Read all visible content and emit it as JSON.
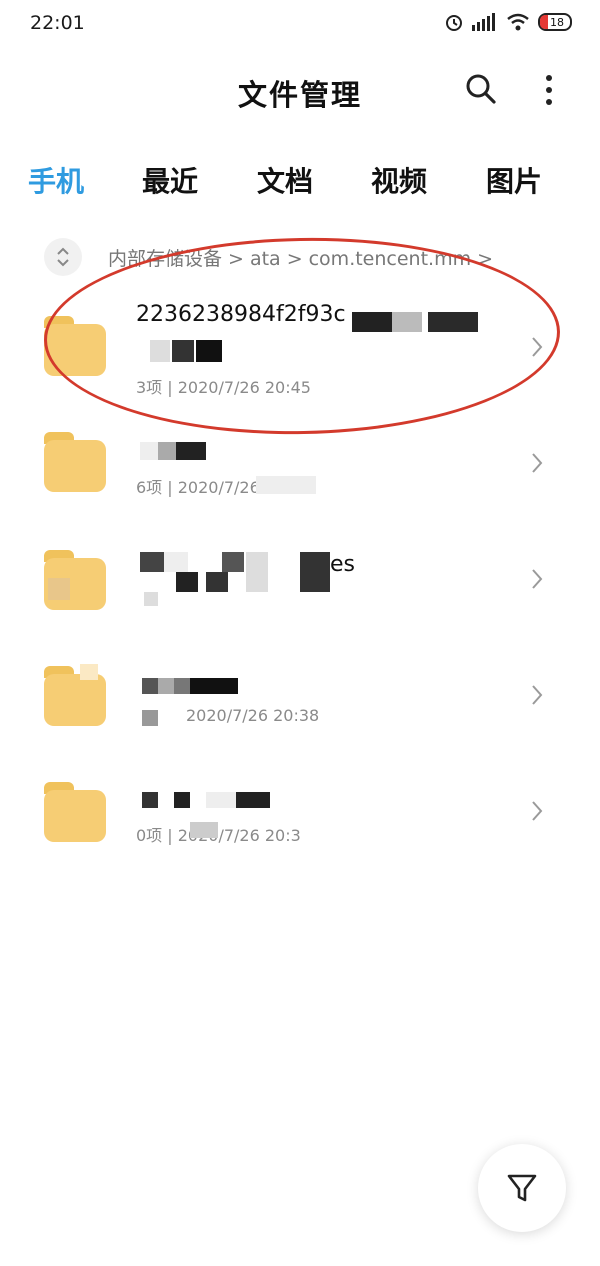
{
  "status_bar": {
    "time": "22:01",
    "battery": "18"
  },
  "header": {
    "title": "文件管理"
  },
  "tabs": [
    {
      "label": "手机",
      "active": true
    },
    {
      "label": "最近"
    },
    {
      "label": "文档"
    },
    {
      "label": "视频"
    },
    {
      "label": "图片"
    }
  ],
  "breadcrumb": {
    "items": [
      "内部存储设备",
      "ata",
      "com.tencent.mm"
    ]
  },
  "files": [
    {
      "name": "2236238984f2f93c",
      "meta": "3项 | 2020/7/26 20:45"
    },
    {
      "name": "",
      "meta": "6项 | 2020/7/26"
    },
    {
      "name": "es",
      "meta": ""
    },
    {
      "name": "",
      "meta": "2020/7/26 20:38"
    },
    {
      "name": "",
      "meta": "0项 | 2020/7/26 20:3"
    }
  ],
  "colors": {
    "accent": "#2f9be0",
    "folder": "#f6cd74",
    "highlight": "#d33a2c"
  }
}
